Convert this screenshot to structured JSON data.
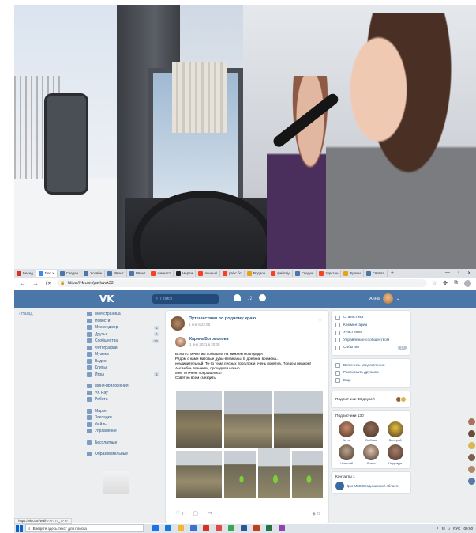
{
  "browser": {
    "tabs": [
      {
        "label": "Бесед",
        "color": "#d93025"
      },
      {
        "label": "Пес ×",
        "color": "#4285f4",
        "active": true
      },
      {
        "label": "Сведен",
        "color": "#4a76a8"
      },
      {
        "label": "Хозяйн",
        "color": "#4a76a8"
      },
      {
        "label": "ВКонт",
        "color": "#4a76a8"
      },
      {
        "label": "ВКонт",
        "color": "#4a76a8"
      },
      {
        "label": "гимнаст",
        "color": "#fc3f1d"
      },
      {
        "label": "Нерви",
        "color": "#222222"
      },
      {
        "label": "личный",
        "color": "#fc3f1d"
      },
      {
        "label": "рейс бс",
        "color": "#fc3f1d"
      },
      {
        "label": "Родион",
        "color": "#e3a21a"
      },
      {
        "label": "фейсбу",
        "color": "#fc3f1d"
      },
      {
        "label": "Сведен",
        "color": "#4a76a8"
      },
      {
        "label": "турстан",
        "color": "#fc3f1d"
      },
      {
        "label": "Брюки",
        "color": "#e3a21a"
      },
      {
        "label": "Светла",
        "color": "#4a76a8"
      }
    ],
    "new_tab": "+",
    "window_controls": {
      "minimize": "—",
      "maximize": "▫",
      "close": "✕"
    },
    "url": "https://vk.com/pavlovsk33",
    "nav": {
      "back": "←",
      "forward": "→",
      "reload": "⟳"
    },
    "status_url": "https://vk.com/wall-??????_????"
  },
  "vk": {
    "logo": "VK",
    "search_placeholder": "Поиск",
    "user_name": "Анна",
    "back_link": "‹ Назад",
    "nav": [
      {
        "label": "Моя страница",
        "icon": "home-icon"
      },
      {
        "label": "Новости",
        "icon": "news-icon"
      },
      {
        "label": "Мессенджер",
        "icon": "messenger-icon",
        "badge": "1"
      },
      {
        "label": "Друзья",
        "icon": "friends-icon",
        "badge": "1"
      },
      {
        "label": "Сообщества",
        "icon": "groups-icon",
        "badge": "72"
      },
      {
        "label": "Фотографии",
        "icon": "photos-icon"
      },
      {
        "label": "Музыка",
        "icon": "music-icon"
      },
      {
        "label": "Видео",
        "icon": "video-icon"
      },
      {
        "label": "Клипы",
        "icon": "clips-icon"
      },
      {
        "label": "Игры",
        "icon": "games-icon",
        "badge": "1"
      }
    ],
    "nav2": [
      {
        "label": "Мини-приложения",
        "icon": "apps-icon"
      },
      {
        "label": "VK Pay",
        "icon": "vkpay-icon"
      },
      {
        "label": "Работа",
        "icon": "work-icon"
      }
    ],
    "nav3": [
      {
        "label": "Маркет",
        "icon": "market-icon"
      },
      {
        "label": "Закладки",
        "icon": "bookmarks-icon"
      },
      {
        "label": "Файлы",
        "icon": "files-icon"
      },
      {
        "label": "Управление",
        "icon": "manage-icon"
      }
    ],
    "nav4": [
      {
        "label": "Бесплатные",
        "icon": "free-icon"
      }
    ],
    "nav5": [
      {
        "label": "Образовательные",
        "icon": "education-icon"
      }
    ],
    "post": {
      "group_name": "Путешествия по родному краю",
      "group_date": "1 янв в 22:55",
      "author_name": "Карина Богомолова",
      "author_date": "1 янв 2021 в 20:08",
      "text_lines": [
        "В этот стоечке мы побывали на Нижнем Новгороде!",
        "Рядом с нами матовые дубы-великаны. В древние времена...",
        "неудивительный. То-то тема лесных прогулок и очень понятна. Поедем пешком!",
        "Ансамбль возникли, проходили ночью.",
        "Мне то очень понравилось!",
        "Советую всем съездить."
      ],
      "likes": "8",
      "comments": "",
      "shares": "",
      "views": "72"
    },
    "right_menu": [
      {
        "label": "Статистика",
        "icon": "stats-icon"
      },
      {
        "label": "Комментарии",
        "icon": "comments-icon"
      },
      {
        "label": "Участники",
        "icon": "members-icon"
      },
      {
        "label": "Управление сообществом",
        "icon": "settings-icon"
      },
      {
        "label": "События",
        "icon": "events-icon",
        "badge": "13"
      }
    ],
    "right_menu2": [
      {
        "label": "Включить уведомления",
        "icon": "notify-icon"
      },
      {
        "label": "Рассказать друзьям",
        "icon": "share-icon"
      },
      {
        "label": "Ещё",
        "icon": "more-icon"
      }
    ],
    "subscribers_label": "Подписчики 48 друзей",
    "friends_label": "Подписчики 130",
    "friends": [
      {
        "name": "Алла",
        "color": "#c98b6b"
      },
      {
        "name": "Любовь",
        "color": "#8e6b58"
      },
      {
        "name": "Валерий",
        "color": "#e5c13a"
      },
      {
        "name": "Николай",
        "color": "#b9a38f"
      },
      {
        "name": "Ольга",
        "color": "#d9c2ad"
      },
      {
        "name": "Надежда",
        "color": "#a67c6a"
      }
    ],
    "contacts_label": "Контакты 1",
    "contact_name": "Дом МКО Владимирской области"
  },
  "taskbar": {
    "search_placeholder": "Введите здесь текст для поиска",
    "lang": "РУС",
    "time": "00:00"
  }
}
